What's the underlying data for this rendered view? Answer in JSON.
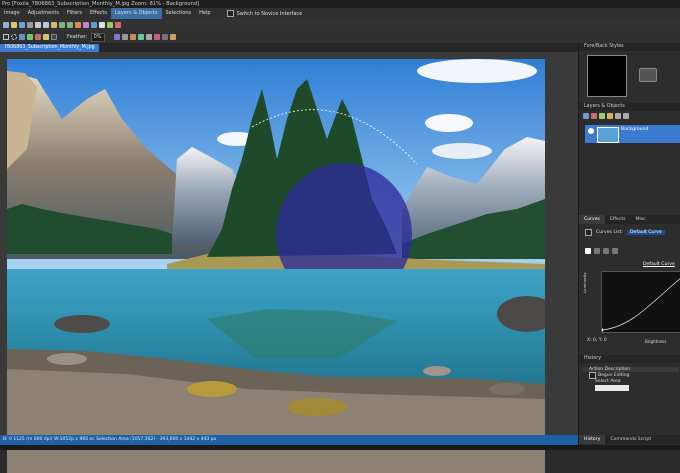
{
  "window": {
    "title": "Pro [Foxila_7806863_Subscription_Monthly_M.jpg Zoom: 81% - Background]"
  },
  "menu": [
    "Image",
    "Adjustments",
    "Filters",
    "Effects",
    "Layers & Objects",
    "Selections",
    "Help"
  ],
  "menu_active_index": 4,
  "toolbar": {
    "switch_label": "Switch to Novice Interface",
    "feather_label": "Feather:",
    "feather_value": "0%"
  },
  "document": {
    "tab_label": "7806863_Subscription_Monthly_M.jpg"
  },
  "status": {
    "text": "B: 0 1125 (m 000 dpi)    W:1052p x 960 ec    Selection Area (1057,562) - 393,600 x 1442 x 443 px"
  },
  "panels": {
    "fore_back_title": "Fore/Back Styles",
    "layers_title": "Layers & Objects",
    "layer_name": "Background",
    "curves_tabs": [
      "Curves",
      "Effects",
      "Misc"
    ],
    "curves_list_label": "Curves List:",
    "curves_list_value": "Default Curve",
    "curve_name": "Default Curve",
    "curve_x_label": "Brightness",
    "curve_y_label": "Luminosity",
    "xy_readout": "X: 0, Y: 0",
    "history_title": "History",
    "history_items": [
      "Action Description",
      "Begun Editing",
      "Select Area"
    ],
    "bottom_tabs": [
      "History",
      "Commands Script"
    ]
  },
  "colors": {
    "accent": "#3c7bd0",
    "status_bar": "#1f5fa6",
    "selection_fill": "#2d2b9a"
  }
}
